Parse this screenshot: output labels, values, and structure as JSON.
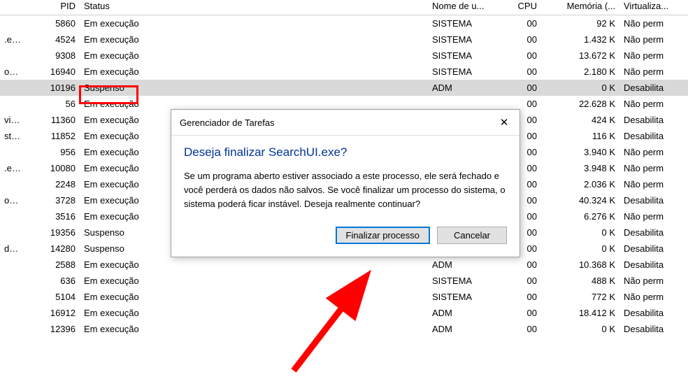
{
  "columns": {
    "pid": "PID",
    "status": "Status",
    "user": "Nome de u...",
    "cpu": "CPU",
    "mem": "Memória (...",
    "virt": "Virtualiza..."
  },
  "rows": [
    {
      "imgname": "",
      "pid": "5860",
      "status": "Em execução",
      "user": "SISTEMA",
      "cpu": "00",
      "mem": "92 K",
      "virt": "Não perm"
    },
    {
      "imgname": ".exe",
      "pid": "4524",
      "status": "Em execução",
      "user": "SISTEMA",
      "cpu": "00",
      "mem": "1.432 K",
      "virt": "Não perm"
    },
    {
      "imgname": "",
      "pid": "9308",
      "status": "Em execução",
      "user": "SISTEMA",
      "cpu": "00",
      "mem": "13.672 K",
      "virt": "Não perm"
    },
    {
      "imgname": "ost...",
      "pid": "16940",
      "status": "Em execução",
      "user": "SISTEMA",
      "cpu": "00",
      "mem": "2.180 K",
      "virt": "Não perm"
    },
    {
      "imgname": "",
      "pid": "10196",
      "status": "Suspenso",
      "user": "ADM",
      "cpu": "00",
      "mem": "0 K",
      "virt": "Desabilita",
      "selected": true
    },
    {
      "imgname": "",
      "pid": "56",
      "status": "Em execução",
      "user": "",
      "cpu": "00",
      "mem": "22.628 K",
      "virt": "Não perm"
    },
    {
      "imgname": "vic...",
      "pid": "11360",
      "status": "Em execução",
      "user": "",
      "cpu": "00",
      "mem": "424 K",
      "virt": "Desabilita"
    },
    {
      "imgname": "stra...",
      "pid": "11852",
      "status": "Em execução",
      "user": "",
      "cpu": "00",
      "mem": "116 K",
      "virt": "Desabilita"
    },
    {
      "imgname": "",
      "pid": "956",
      "status": "Em execução",
      "user": "",
      "cpu": "00",
      "mem": "3.940 K",
      "virt": "Não perm"
    },
    {
      "imgname": ".exe",
      "pid": "10080",
      "status": "Em execução",
      "user": "",
      "cpu": "00",
      "mem": "3.948 K",
      "virt": "Não perm"
    },
    {
      "imgname": "",
      "pid": "2248",
      "status": "Em execução",
      "user": "",
      "cpu": "00",
      "mem": "2.036 K",
      "virt": "Não perm"
    },
    {
      "imgname": "ost...",
      "pid": "3728",
      "status": "Em execução",
      "user": "",
      "cpu": "00",
      "mem": "40.324 K",
      "virt": "Desabilita"
    },
    {
      "imgname": "",
      "pid": "3516",
      "status": "Em execução",
      "user": "",
      "cpu": "00",
      "mem": "6.276 K",
      "virt": "Não perm"
    },
    {
      "imgname": "",
      "pid": "19356",
      "status": "Suspenso",
      "user": "",
      "cpu": "00",
      "mem": "0 K",
      "virt": "Desabilita"
    },
    {
      "imgname": "dH...",
      "pid": "14280",
      "status": "Suspenso",
      "user": "",
      "cpu": "00",
      "mem": "0 K",
      "virt": "Desabilita"
    },
    {
      "imgname": "",
      "pid": "2588",
      "status": "Em execução",
      "user": "ADM",
      "cpu": "00",
      "mem": "10.368 K",
      "virt": "Desabilita"
    },
    {
      "imgname": "",
      "pid": "636",
      "status": "Em execução",
      "user": "SISTEMA",
      "cpu": "00",
      "mem": "488 K",
      "virt": "Não perm"
    },
    {
      "imgname": "",
      "pid": "5104",
      "status": "Em execução",
      "user": "SISTEMA",
      "cpu": "00",
      "mem": "772 K",
      "virt": "Não perm"
    },
    {
      "imgname": "",
      "pid": "16912",
      "status": "Em execução",
      "user": "ADM",
      "cpu": "00",
      "mem": "18.412 K",
      "virt": "Desabilita"
    },
    {
      "imgname": "",
      "pid": "12396",
      "status": "Em execução",
      "user": "ADM",
      "cpu": "00",
      "mem": "0 K",
      "virt": "Desabilita"
    }
  ],
  "dialog": {
    "title": "Gerenciador de Tarefas",
    "heading": "Deseja finalizar SearchUI.exe?",
    "body": "Se um programa aberto estiver associado a este processo, ele será fechado e você perderá os dados não salvos. Se você finalizar um processo do sistema, o sistema poderá ficar instável. Deseja realmente continuar?",
    "confirm": "Finalizar processo",
    "cancel": "Cancelar",
    "close_symbol": "✕"
  }
}
